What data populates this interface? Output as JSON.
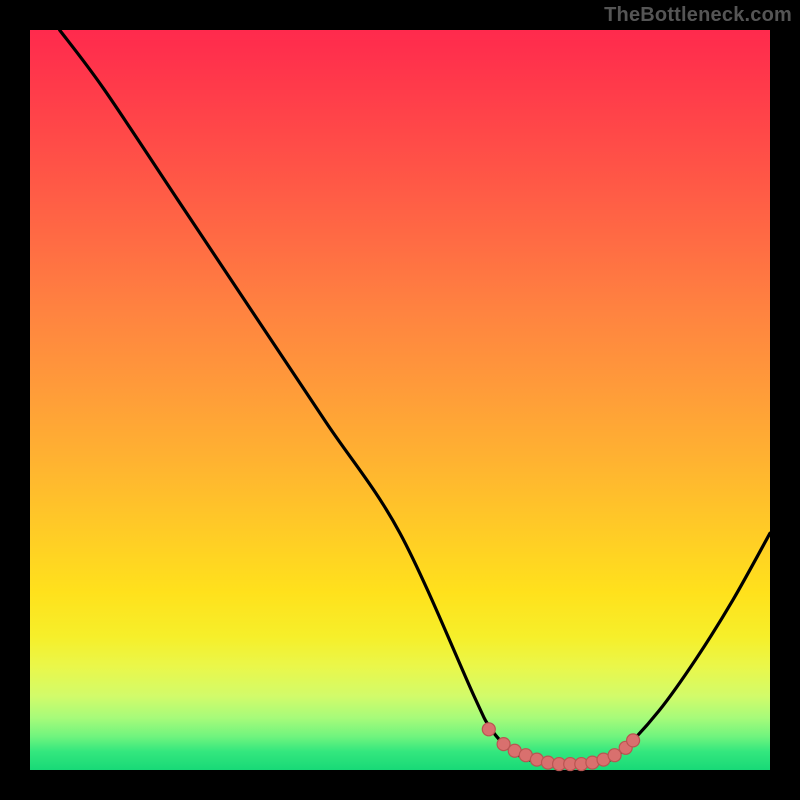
{
  "watermark": "TheBottleneck.com",
  "colors": {
    "background": "#000000",
    "curve_stroke": "#000000",
    "marker_fill": "#d9706e",
    "marker_stroke": "#b95552",
    "gradient_top": "#ff2a4d",
    "gradient_bottom": "#18d977"
  },
  "chart_data": {
    "type": "line",
    "title": "",
    "xlabel": "",
    "ylabel": "",
    "xlim": [
      0,
      100
    ],
    "ylim": [
      0,
      100
    ],
    "grid": false,
    "series": [
      {
        "name": "bottleneck-curve",
        "x": [
          4,
          10,
          20,
          30,
          40,
          50,
          60,
          62,
          64,
          66,
          68,
          70,
          72,
          74,
          76,
          78,
          80,
          85,
          90,
          95,
          100
        ],
        "y": [
          100,
          92,
          77,
          62,
          47,
          32,
          10,
          6,
          3.5,
          2,
          1.2,
          0.8,
          0.7,
          0.7,
          0.8,
          1.2,
          2.5,
          8,
          15,
          23,
          32
        ]
      }
    ],
    "markers": {
      "name": "sweet-spot",
      "x": [
        62,
        64,
        65.5,
        67,
        68.5,
        70,
        71.5,
        73,
        74.5,
        76,
        77.5,
        79,
        80.5
      ],
      "y": [
        5.5,
        3.5,
        2.6,
        2.0,
        1.4,
        1.0,
        0.8,
        0.8,
        0.8,
        1.0,
        1.4,
        2.0,
        3.0
      ]
    },
    "extra_marker": {
      "x": 81.5,
      "y": 4.0
    }
  }
}
